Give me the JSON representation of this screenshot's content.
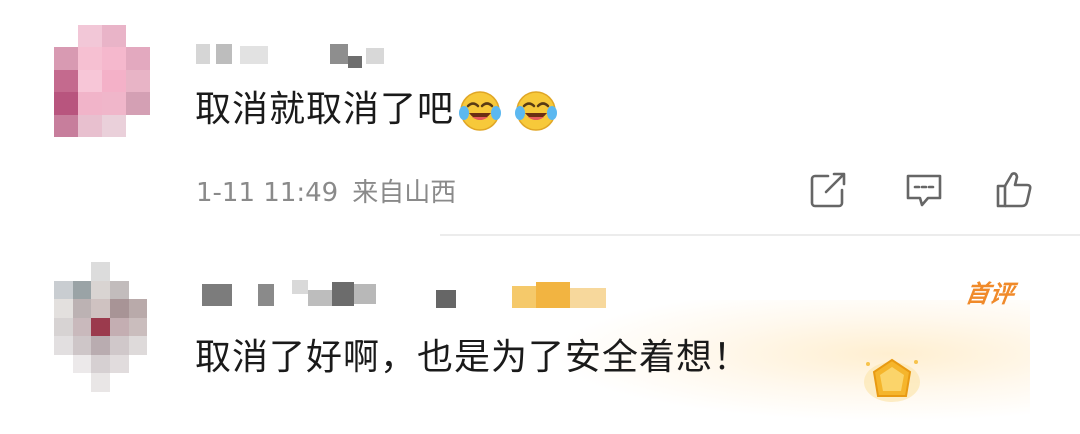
{
  "comments": [
    {
      "text": "取消就取消了吧",
      "emojis": [
        "crying-laughing-emoji",
        "crying-laughing-emoji"
      ],
      "date": "1-11 11:49",
      "location": "来自山西",
      "actions": [
        "share-icon",
        "comment-icon",
        "like-icon"
      ]
    },
    {
      "text": "取消了好啊，也是为了安全着想！",
      "badge": "首评",
      "medal": "medal-icon"
    }
  ],
  "colors": {
    "meta_gray": "#8a8a8a",
    "text": "#1a1a1a",
    "badge_orange": "#f08a2a",
    "divider": "#ececec"
  }
}
